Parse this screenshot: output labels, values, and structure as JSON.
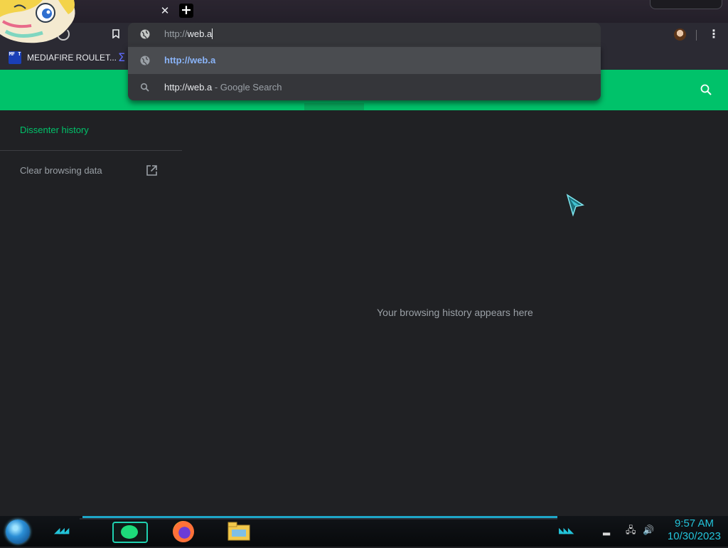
{
  "browser": {
    "tab_close_glyph": "✕",
    "new_tab_glyph": "+",
    "menu_glyph": "⋮",
    "bookmarks": [
      {
        "icon": "mediafire-roulette-favicon",
        "favicon_text": "MF T",
        "label": "MEDIAFIRE ROULET..."
      }
    ],
    "omnibox": {
      "scheme": "http://",
      "typed": "web.a"
    },
    "suggestions": [
      {
        "icon": "globe-icon",
        "text": "http://web.a",
        "selected": true
      },
      {
        "icon": "search-icon",
        "query": "http://web.a",
        "suffix": " - Google Search",
        "selected": false
      }
    ]
  },
  "page": {
    "nav": {
      "title": "Dissenter history",
      "clear_label": "Clear browsing data"
    },
    "empty_message": "Your browsing history appears here",
    "accent_color": "#00c26a"
  },
  "taskbar": {
    "apps": [
      "messages-app-icon",
      "firefox-icon",
      "file-explorer-icon"
    ],
    "clock_time": "9:57 AM",
    "clock_date": "10/30/2023"
  }
}
